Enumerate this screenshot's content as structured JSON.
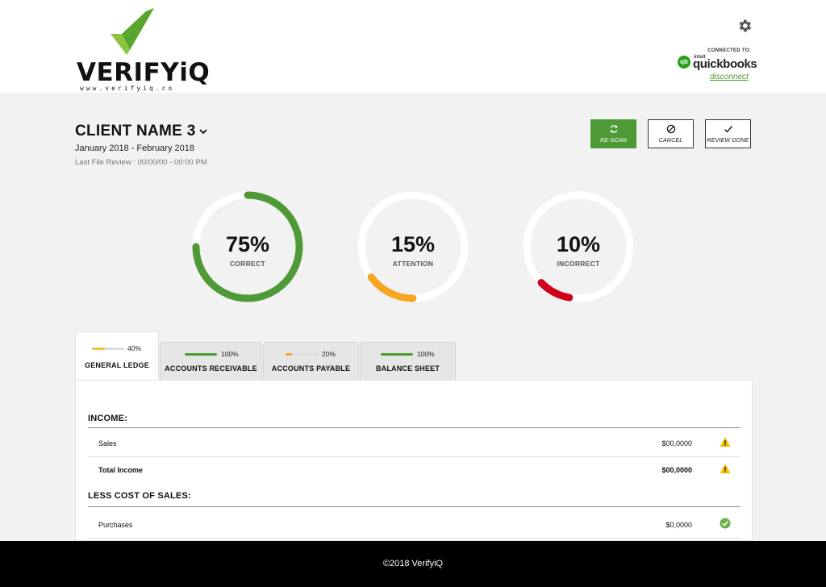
{
  "brand": {
    "name": "VERIFYiQ",
    "url": "www.verifyiq.co",
    "check_color_dark": "#5aa52f",
    "check_color_light": "#8cc63f"
  },
  "integration": {
    "connected_label": "CONNECTED TO:",
    "intuit_label": "intuit",
    "provider": "quickbooks",
    "disconnect_label": "disconnect"
  },
  "client": {
    "name": "CLIENT NAME 3",
    "date_range": "January 2018 - February 2018",
    "last_review": "Last File Review : 00/00/00 - 00:00 PM"
  },
  "actions": {
    "rescan": "RE-SCAN",
    "cancel": "CANCEL",
    "review_done": "REVIEW DONE"
  },
  "gauges": [
    {
      "value": "75%",
      "label": "CORRECT",
      "fraction": 0.75,
      "color": "#4f9a37"
    },
    {
      "value": "15%",
      "label": "ATTENTION",
      "fraction": 0.15,
      "color": "#f5a623"
    },
    {
      "value": "10%",
      "label": "INCORRECT",
      "fraction": 0.1,
      "color": "#d0021b"
    }
  ],
  "tabs": [
    {
      "label": "GENERAL LEDGE",
      "percent": "40%",
      "fraction": 0.4,
      "color": "#f5c242",
      "active": true
    },
    {
      "label": "ACCOUNTS RECEIVABLE",
      "percent": "100%",
      "fraction": 1.0,
      "color": "#4f9a37",
      "active": false
    },
    {
      "label": "ACCOUNTS PAYABLE",
      "percent": "20%",
      "fraction": 0.2,
      "color": "#f5a623",
      "active": false
    },
    {
      "label": "BALANCE SHEET",
      "percent": "100%",
      "fraction": 1.0,
      "color": "#4f9a37",
      "active": false
    }
  ],
  "report": {
    "income_title": "INCOME:",
    "income_rows": [
      {
        "label": "Sales",
        "amount": "$00,0000",
        "status": "warning"
      },
      {
        "label": "Total Income",
        "amount": "$00,0000",
        "status": "warning"
      }
    ],
    "cogs_title": "LESS COST OF SALES:",
    "cogs_rows": [
      {
        "label": "Purchases",
        "amount": "$0,0000",
        "status": "ok"
      }
    ]
  },
  "footer": {
    "copyright": "©2018 VerifyiQ"
  }
}
